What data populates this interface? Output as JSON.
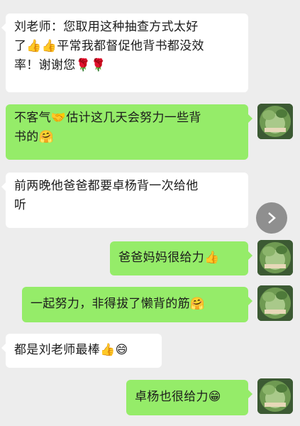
{
  "messages": [
    {
      "side": "left",
      "lines": [
        "刘老师：您取用这种抽查方式太好",
        "了👍👍平常我都督促他背书都没效",
        "率！谢谢您🌹🌹"
      ]
    },
    {
      "side": "right",
      "lines": [
        "不客气🤝估计这几天会努力一些背",
        "书的🤗"
      ]
    },
    {
      "side": "left",
      "lines": [
        "前两晚他爸爸都要卓杨背一次给他",
        "听"
      ]
    },
    {
      "side": "right",
      "lines": [
        "爸爸妈妈很给力👍"
      ]
    },
    {
      "side": "right",
      "lines": [
        "一起努力，非得拔了懒背的筋🤗"
      ]
    },
    {
      "side": "left",
      "lines": [
        "都是刘老师最棒👍😄"
      ]
    },
    {
      "side": "right",
      "lines": [
        "卓杨也很给力😁"
      ]
    }
  ],
  "icons": {
    "avatar": "avatar-photo-icon",
    "forward": "chevron-right-icon"
  },
  "colors": {
    "background": "#ededed",
    "incoming_bubble": "#ffffff",
    "outgoing_bubble": "#95ec69",
    "forward_button": "#8f8f8f"
  }
}
